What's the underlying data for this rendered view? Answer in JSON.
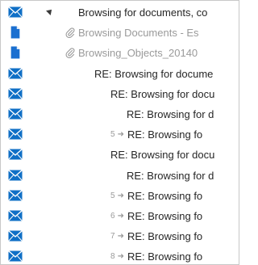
{
  "rows": [
    {
      "icon": "mail-icon",
      "has_expander": true,
      "indent": 96,
      "subject": "Browsing for documents, co"
    },
    {
      "icon": "document-icon",
      "attachment": true,
      "indent": 96,
      "subject": "Browsing Documents - Es"
    },
    {
      "icon": "document-icon",
      "attachment": true,
      "indent": 96,
      "subject": "Browsing_Objects_20140"
    },
    {
      "icon": "mail-icon",
      "indent": 116,
      "subject": "RE: Browsing for docume"
    },
    {
      "icon": "mail-icon",
      "indent": 136,
      "subject": "RE: Browsing for docu"
    },
    {
      "icon": "mail-icon",
      "indent": 156,
      "subject": "RE: Browsing for d"
    },
    {
      "icon": "mail-icon",
      "indent": 156,
      "thread_level": "5",
      "subject": "RE: Browsing fo"
    },
    {
      "icon": "mail-icon",
      "indent": 136,
      "subject": "RE: Browsing for docu"
    },
    {
      "icon": "mail-icon",
      "indent": 156,
      "subject": "RE: Browsing for d"
    },
    {
      "icon": "mail-icon",
      "indent": 156,
      "thread_level": "5",
      "subject": "RE: Browsing fo"
    },
    {
      "icon": "mail-icon",
      "indent": 156,
      "thread_level": "6",
      "subject": "RE: Browsing fo"
    },
    {
      "icon": "mail-icon",
      "indent": 156,
      "thread_level": "7",
      "subject": "RE: Browsing fo"
    },
    {
      "icon": "mail-icon",
      "indent": 156,
      "thread_level": "8",
      "subject": "RE: Browsing fo"
    }
  ],
  "colors": {
    "mail_icon": "#0f6fc6",
    "doc_icon": "#1a6fd0",
    "text": "#262626",
    "muted": "#9a9a9a"
  }
}
